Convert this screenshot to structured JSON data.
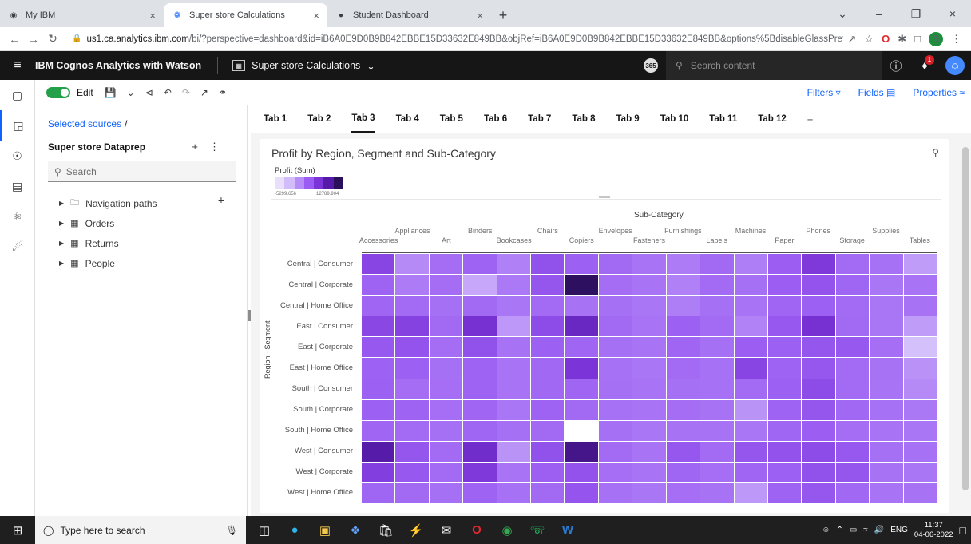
{
  "browser": {
    "tabs": [
      {
        "label": "My IBM",
        "active": false
      },
      {
        "label": "Super store Calculations",
        "active": true
      },
      {
        "label": "Student Dashboard",
        "active": false
      }
    ],
    "url_host": "us1.ca.analytics.ibm.com",
    "url_path": "/bi/?perspective=dashboard&id=iB6A0E9D0B9B842EBBE15D33632E849BB&objRef=iB6A0E9D0B9B842EBBE15D33632E849BB&options%5BdisableGlassPrefetch..."
  },
  "header": {
    "brand": "IBM Cognos Analytics with Watson",
    "dashboard_name": "Super store Calculations",
    "badge": "365",
    "search_placeholder": "Search content",
    "notification_count": "1"
  },
  "toolbar": {
    "edit_label": "Edit",
    "filters_label": "Filters",
    "fields_label": "Fields",
    "properties_label": "Properties"
  },
  "datapanel": {
    "selected_sources": "Selected sources",
    "separator": "/",
    "source_name": "Super store Dataprep",
    "search_placeholder": "Search",
    "items": [
      {
        "label": "Navigation paths",
        "icon": "folder-icon"
      },
      {
        "label": "Orders",
        "icon": "table-icon"
      },
      {
        "label": "Returns",
        "icon": "table-icon"
      },
      {
        "label": "People",
        "icon": "table-icon"
      }
    ]
  },
  "dashboard_tabs": [
    "Tab 1",
    "Tab 2",
    "Tab 3",
    "Tab 4",
    "Tab 5",
    "Tab 6",
    "Tab 7",
    "Tab 8",
    "Tab 9",
    "Tab 10",
    "Tab 11",
    "Tab 12"
  ],
  "active_tab": "Tab 3",
  "widget": {
    "title": "Profit by Region, Segment and Sub-Category",
    "legend_title": "Profit (Sum)",
    "legend_min": "-5299.656",
    "legend_max": "12789.904"
  },
  "chart_data": {
    "type": "heatmap",
    "title": "Profit by Region, Segment and Sub-Category",
    "xlabel": "Sub-Category",
    "ylabel": "Region - Segment",
    "x": [
      "Accessories",
      "Appliances",
      "Art",
      "Binders",
      "Bookcases",
      "Chairs",
      "Copiers",
      "Envelopes",
      "Fasteners",
      "Furnishings",
      "Labels",
      "Machines",
      "Paper",
      "Phones",
      "Storage",
      "Supplies",
      "Tables"
    ],
    "y": [
      "Central | Consumer",
      "Central | Corporate",
      "Central | Home Office",
      "East | Consumer",
      "East | Corporate",
      "East | Home Office",
      "South | Consumer",
      "South | Corporate",
      "South | Home Office",
      "West | Consumer",
      "West | Corporate",
      "West | Home Office"
    ],
    "color_range": [
      -5299.656,
      12789.904
    ],
    "color_scale": [
      "#e8e0fb",
      "#d2bdfa",
      "#b68cf7",
      "#9a5cf2",
      "#7b34d8",
      "#551aa8",
      "#2a0f5a"
    ],
    "values": [
      [
        3800,
        -1000,
        800,
        1400,
        -400,
        2800,
        1600,
        1000,
        300,
        -100,
        1000,
        -300,
        1800,
        4800,
        900,
        500,
        -2000
      ],
      [
        1400,
        -100,
        800,
        -2600,
        0,
        2400,
        12500,
        800,
        300,
        -400,
        900,
        600,
        1800,
        2600,
        1300,
        200,
        300
      ],
      [
        1200,
        900,
        600,
        1000,
        200,
        900,
        400,
        600,
        200,
        -300,
        600,
        300,
        1200,
        1600,
        900,
        200,
        400
      ],
      [
        3600,
        4000,
        1000,
        5600,
        -1800,
        3300,
        6900,
        1000,
        300,
        1600,
        900,
        -500,
        2200,
        5600,
        1000,
        200,
        -2000
      ],
      [
        2200,
        2600,
        800,
        2800,
        400,
        1600,
        1200,
        600,
        300,
        1200,
        600,
        1800,
        1600,
        2400,
        2200,
        700,
        -3800
      ],
      [
        1500,
        1600,
        600,
        1400,
        300,
        1100,
        5200,
        500,
        200,
        900,
        500,
        3800,
        1400,
        2300,
        900,
        400,
        -1400
      ],
      [
        1600,
        800,
        700,
        1400,
        300,
        1100,
        1200,
        600,
        300,
        600,
        500,
        900,
        1600,
        3300,
        900,
        300,
        -1000
      ],
      [
        1600,
        1400,
        700,
        1200,
        200,
        1400,
        1000,
        500,
        300,
        800,
        400,
        -1500,
        1400,
        2400,
        1100,
        500,
        100
      ],
      [
        1200,
        900,
        600,
        1300,
        600,
        1000,
        -5299.656,
        600,
        200,
        400,
        400,
        200,
        1300,
        1800,
        800,
        300,
        200
      ],
      [
        8800,
        2400,
        900,
        6200,
        -1500,
        2800,
        10400,
        900,
        300,
        2300,
        900,
        2400,
        2700,
        3300,
        2200,
        600,
        500
      ],
      [
        4400,
        2200,
        900,
        4800,
        300,
        1700,
        2700,
        700,
        300,
        1300,
        700,
        1200,
        1600,
        2800,
        2400,
        400,
        200
      ],
      [
        1300,
        1000,
        600,
        1400,
        500,
        1000,
        2500,
        500,
        200,
        700,
        400,
        -1800,
        1400,
        2300,
        1100,
        300,
        400
      ]
    ]
  }
}
